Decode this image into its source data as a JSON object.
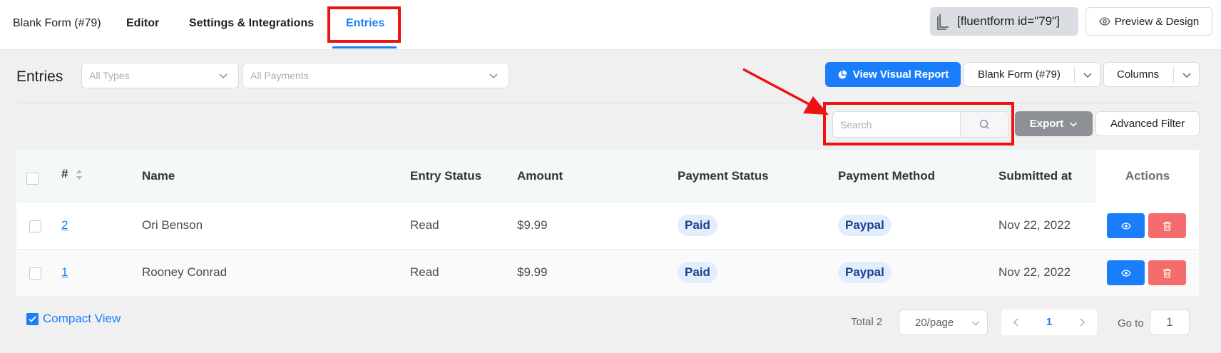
{
  "tabs": [
    {
      "label": "Blank Form (#79)"
    },
    {
      "label": "Editor"
    },
    {
      "label": "Settings & Integrations"
    },
    {
      "label": "Entries"
    }
  ],
  "shortcode": "[fluentform id=\"79\"]",
  "preview_label": "Preview & Design",
  "page_title": "Entries",
  "filters": {
    "types_placeholder": "All Types",
    "payments_placeholder": "All Payments"
  },
  "toolbar": {
    "visual_report": "View Visual Report",
    "form_select": "Blank Form (#79)",
    "columns": "Columns",
    "search_placeholder": "Search",
    "export": "Export",
    "advanced_filter": "Advanced Filter"
  },
  "table": {
    "headers": {
      "id": "#",
      "name": "Name",
      "entry_status": "Entry Status",
      "amount": "Amount",
      "payment_status": "Payment Status",
      "payment_method": "Payment Method",
      "submitted_at": "Submitted at",
      "actions": "Actions"
    },
    "rows": [
      {
        "id": "2",
        "name": "Ori Benson",
        "entry_status": "Read",
        "amount": "$9.99",
        "payment_status": "Paid",
        "payment_method": "Paypal",
        "submitted_at": "Nov 22, 2022"
      },
      {
        "id": "1",
        "name": "Rooney Conrad",
        "entry_status": "Read",
        "amount": "$9.99",
        "payment_status": "Paid",
        "payment_method": "Paypal",
        "submitted_at": "Nov 22, 2022"
      }
    ]
  },
  "footer": {
    "compact_view": "Compact View",
    "total": "Total 2",
    "page_size": "20/page",
    "current_page": "1",
    "goto_label": "Go to",
    "goto_value": "1"
  },
  "colors": {
    "accent": "#1a7efb",
    "danger": "#f46c6c",
    "highlight": "#ee1313",
    "export_bg": "#8d9095"
  }
}
